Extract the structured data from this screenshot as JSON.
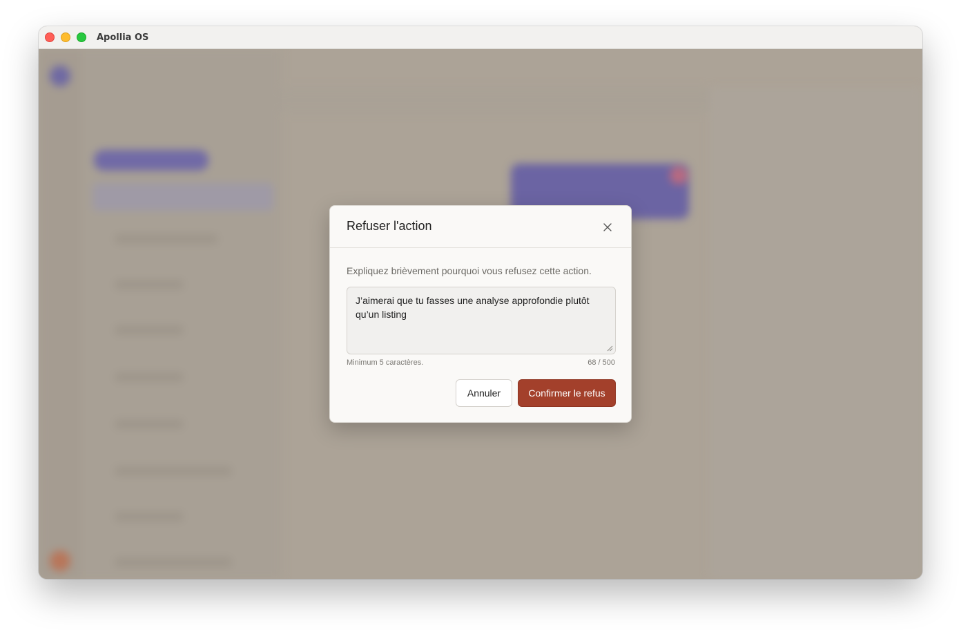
{
  "window": {
    "title": "Apollia OS"
  },
  "dialog": {
    "title": "Refuser l'action",
    "description": "Expliquez brièvement pourquoi vous refusez cette action.",
    "reason_value": "J’aimerai que tu fasses une analyse approfondie plutôt qu’un listing",
    "hint": "Minimum 5 caractères.",
    "counter": "68 / 500",
    "cancel_label": "Annuler",
    "confirm_label": "Confirmer le refus"
  },
  "colors": {
    "confirm_button": "#a3402b",
    "overlay": "#aca397",
    "background_accent": "#6a63a8"
  },
  "icons": {
    "close": "close-icon",
    "resize": "resize-handle-icon"
  }
}
